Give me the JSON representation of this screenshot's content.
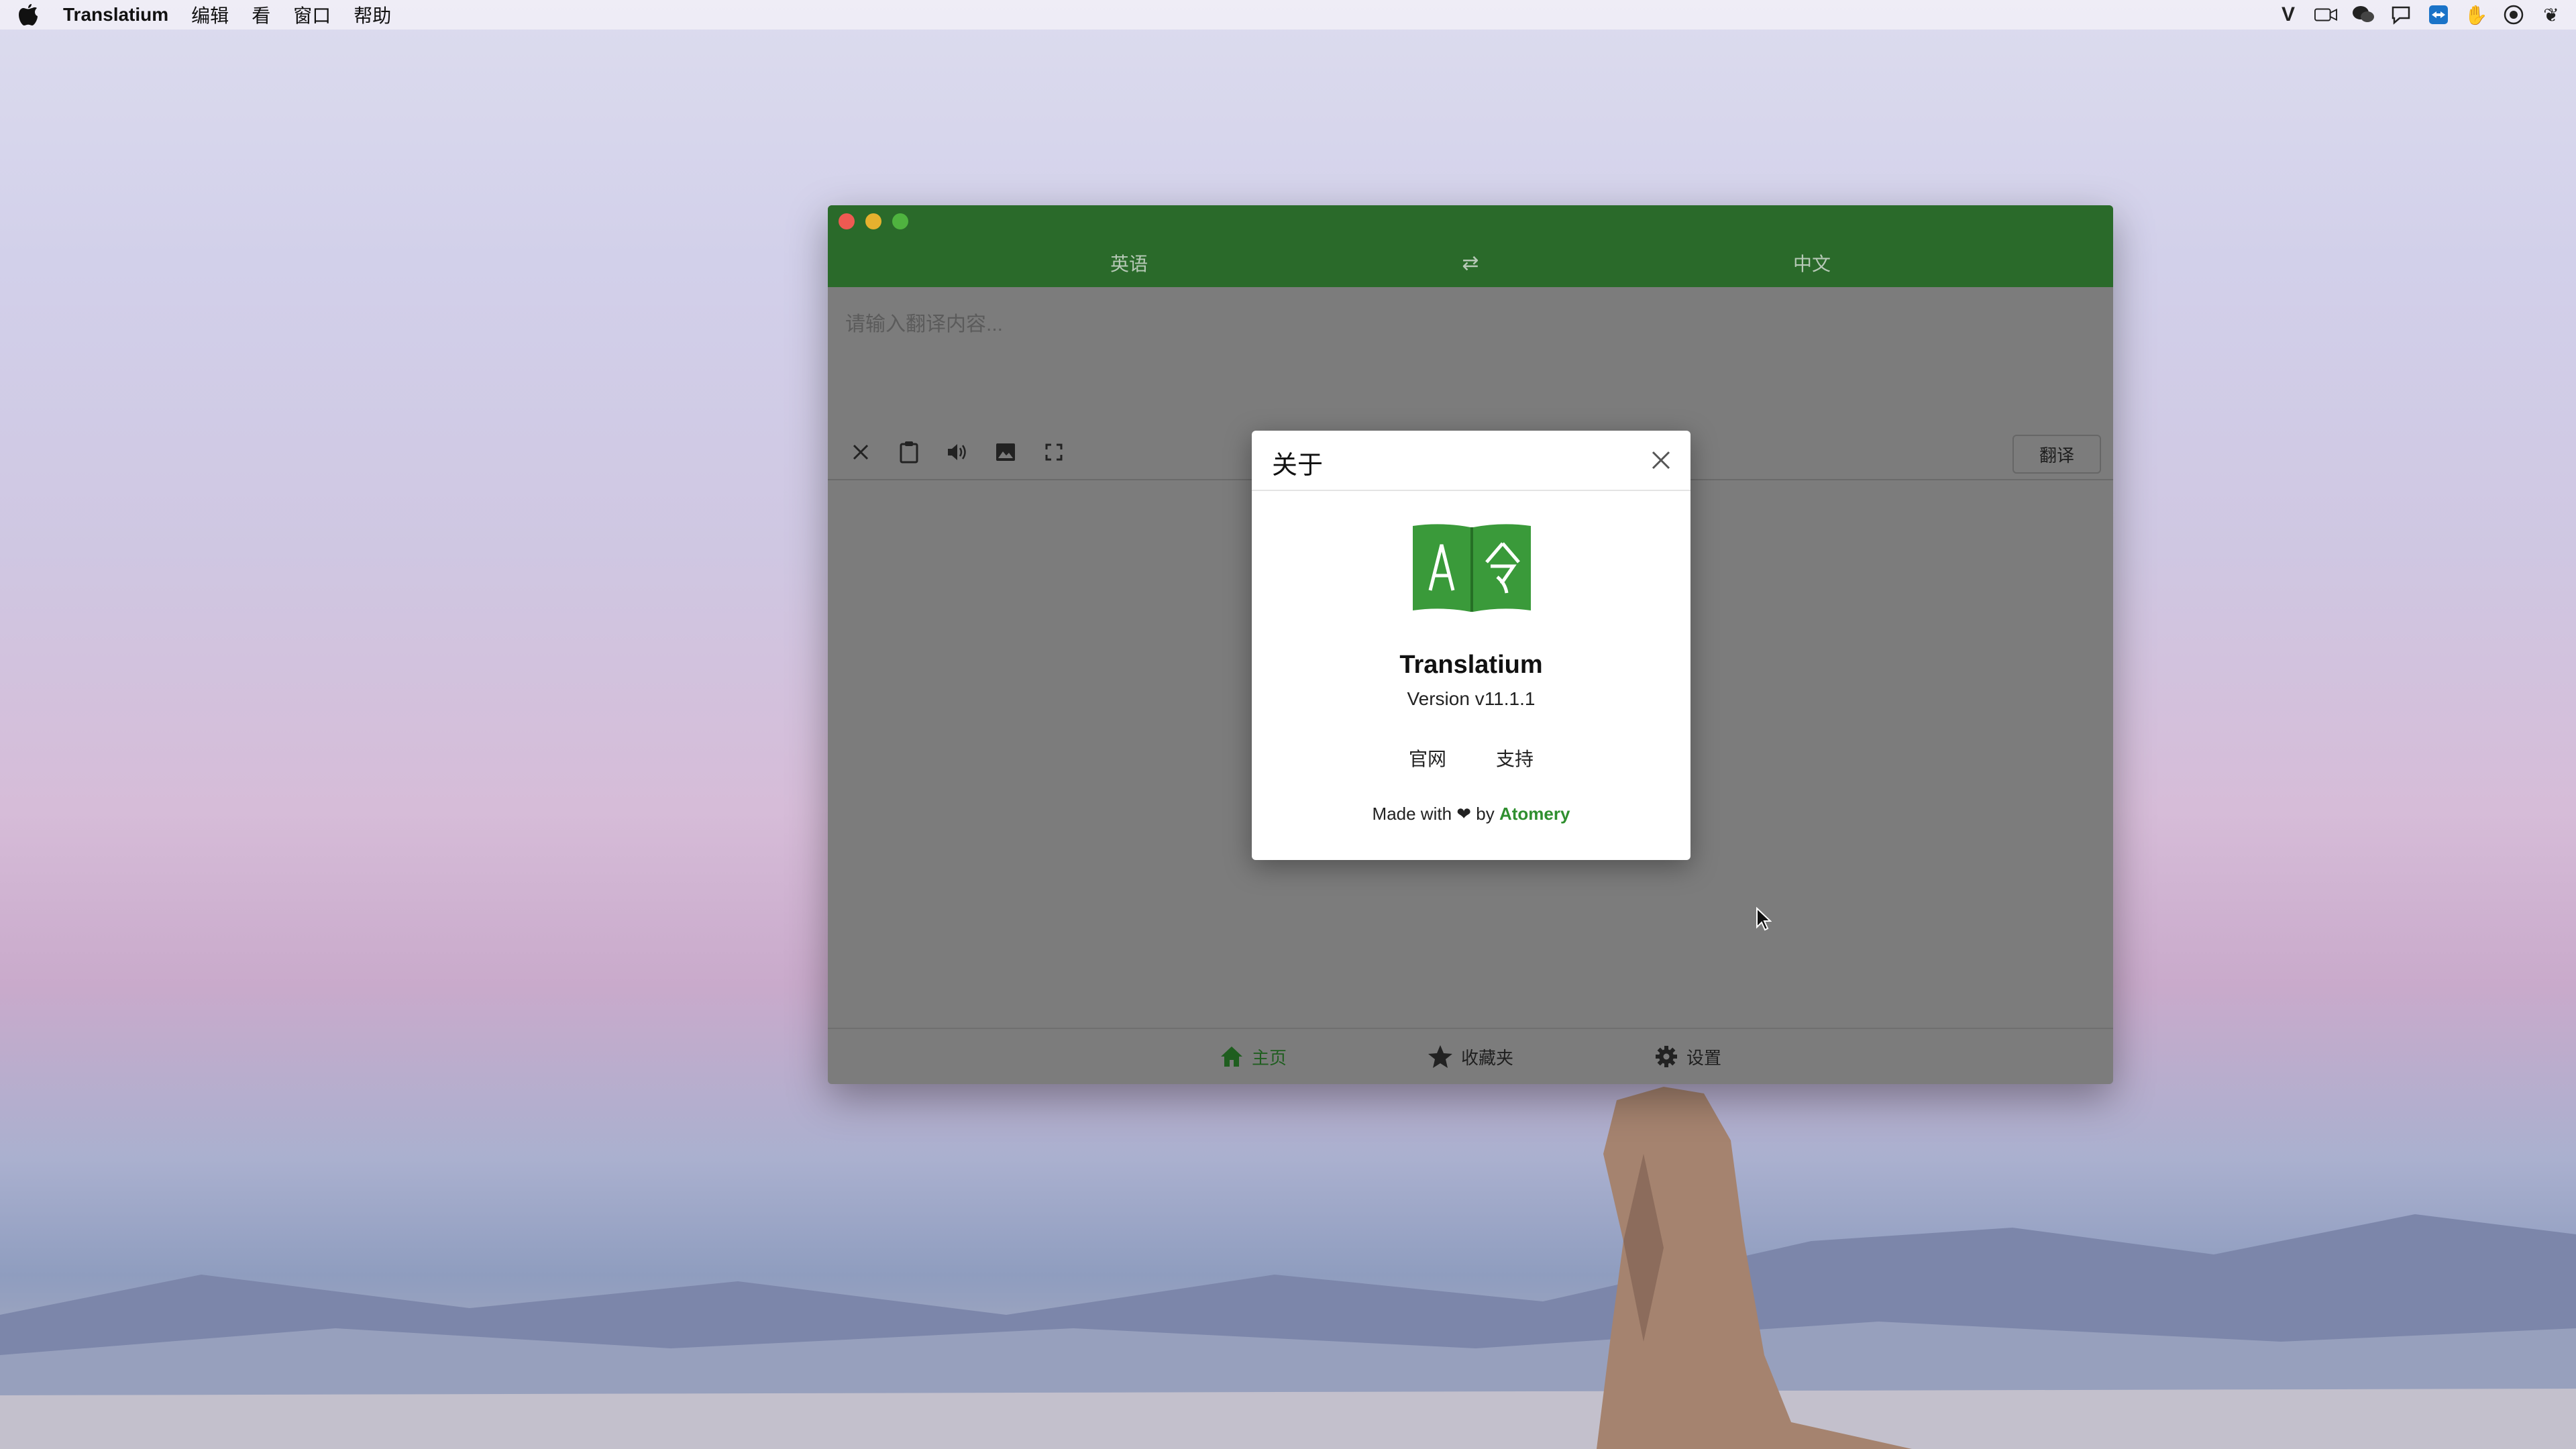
{
  "menubar": {
    "app_name": "Translatium",
    "items": [
      "编辑",
      "看",
      "窗口",
      "帮助"
    ],
    "status_icons": [
      "vimeo-icon",
      "camera-icon",
      "wechat-icon",
      "chat-icon",
      "teamviewer-icon",
      "hand-icon",
      "vpn-icon",
      "paw-icon"
    ]
  },
  "window": {
    "source_language": "英语",
    "swap_symbol": "⇄",
    "target_language": "中文",
    "input_placeholder": "请输入翻译内容...",
    "toolbar": {
      "clear_icon": "close-icon",
      "paste_icon": "clipboard-icon",
      "speak_icon": "speaker-icon",
      "image_icon": "image-icon",
      "fullscreen_icon": "fullscreen-icon",
      "translate_label": "翻译"
    },
    "bottom_nav": [
      {
        "label": "主页",
        "icon": "home-icon",
        "active": true
      },
      {
        "label": "收藏夹",
        "icon": "star-icon",
        "active": false
      },
      {
        "label": "设置",
        "icon": "gear-icon",
        "active": false
      }
    ]
  },
  "about_dialog": {
    "title": "关于",
    "app_name": "Translatium",
    "version": "Version v11.1.1",
    "link_website": "官网",
    "link_support": "支持",
    "made_with": "Made with ❤ by ",
    "brand": "Atomery"
  },
  "colors": {
    "titlebar": "#2a6a2a",
    "brand_green": "#2f8f2f",
    "window_overlay": "#7c7c7c"
  }
}
